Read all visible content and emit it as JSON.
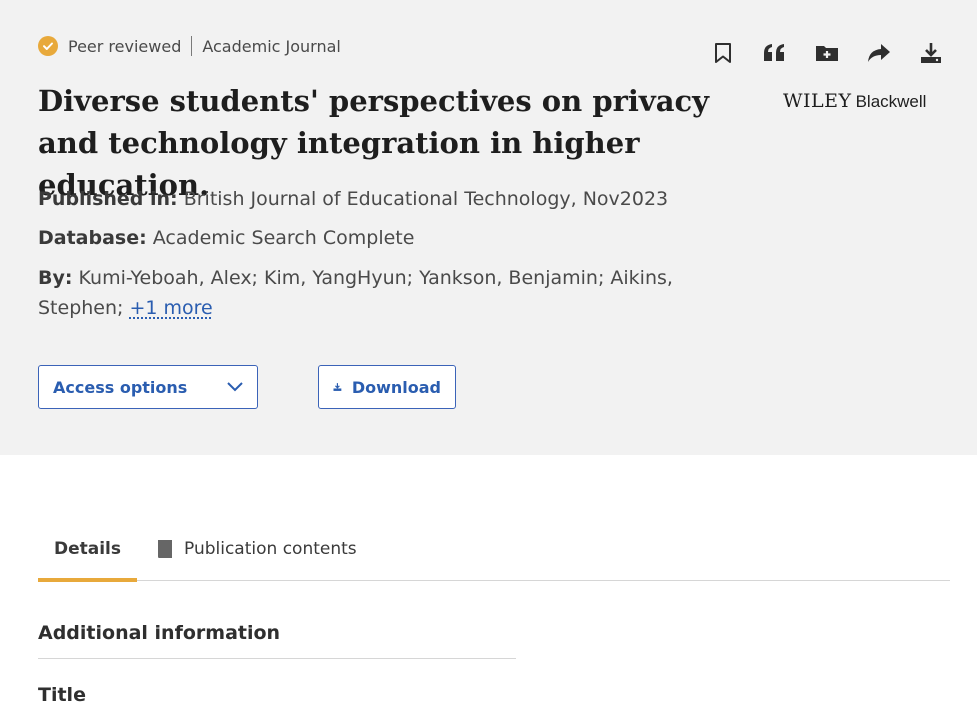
{
  "meta": {
    "peer_reviewed": "Peer reviewed",
    "source_type": "Academic Journal"
  },
  "toolbar": {
    "icons": [
      "bookmark-icon",
      "cite-icon",
      "add-to-folder-icon",
      "share-icon",
      "download-icon"
    ]
  },
  "article": {
    "title": "Diverse students' perspectives on privacy and technology integration in higher education.",
    "publisher_logo": {
      "primary": "WILEY",
      "secondary": "Blackwell"
    },
    "published_in_label": "Published in:",
    "published_in_value": "British Journal of Educational Technology, Nov2023",
    "database_label": "Database:",
    "database_value": "Academic Search Complete",
    "by_label": "By:",
    "authors": "Kumi-Yeboah, Alex; Kim, YangHyun; Yankson, Benjamin; Aikins, Stephen;",
    "more_authors": "+1 more"
  },
  "actions": {
    "access_options": "Access options",
    "download": "Download"
  },
  "tabs": {
    "details": "Details",
    "publication_contents": "Publication contents"
  },
  "details": {
    "section_heading": "Additional information",
    "title_label": "Title"
  },
  "colors": {
    "accent": "#e8a93b",
    "link": "#2a5db0",
    "panel_bg": "#f2f2f2"
  }
}
